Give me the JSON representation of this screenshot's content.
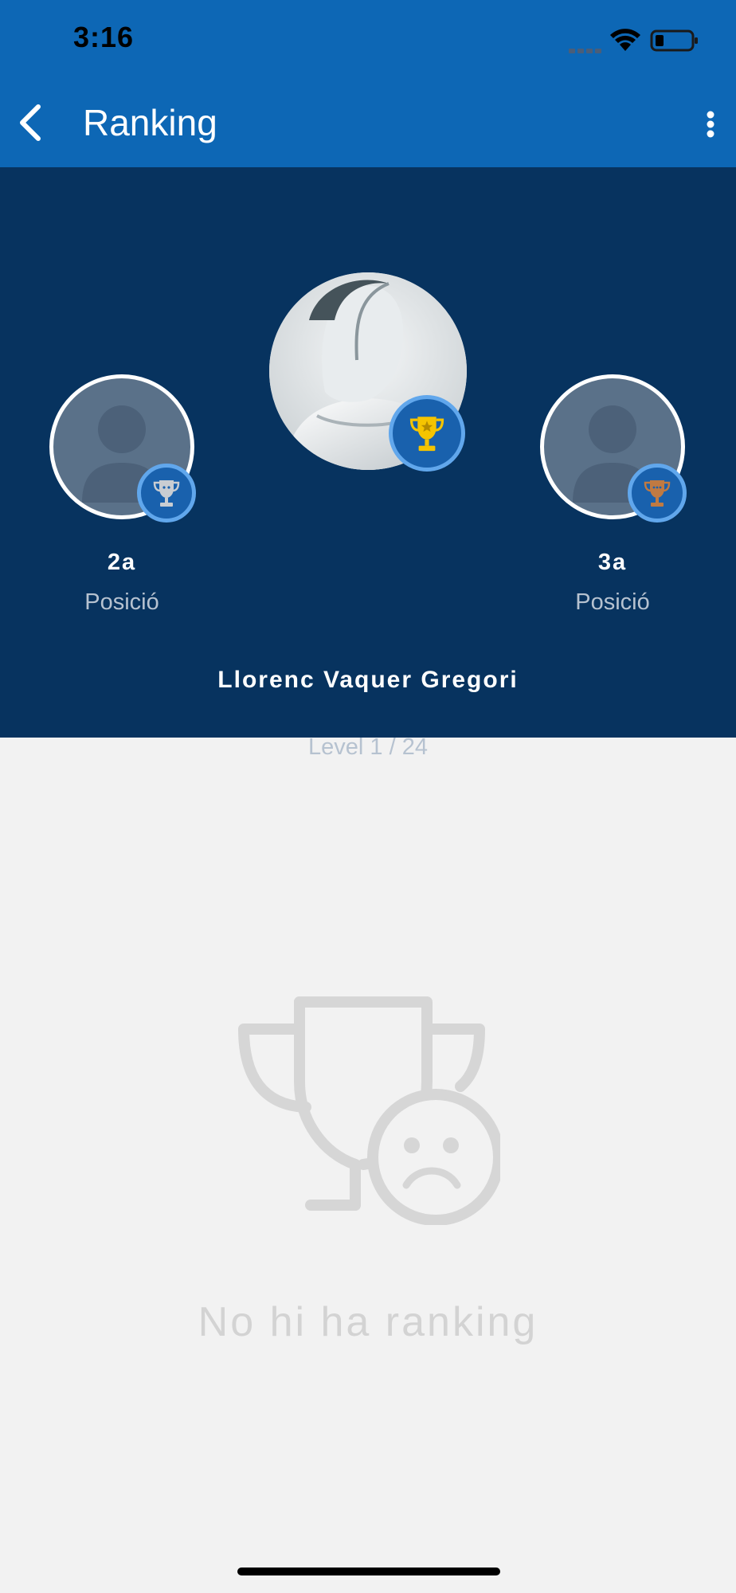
{
  "status_bar": {
    "time": "3:16",
    "icons": [
      "signal-icon",
      "wifi-icon",
      "battery-icon"
    ]
  },
  "app_bar": {
    "title": "Ranking",
    "back_icon": "chevron-left-icon",
    "menu_icon": "more-vertical-icon"
  },
  "podium": {
    "second": {
      "position": "2a",
      "label": "Posició",
      "badge": "silver-trophy-icon"
    },
    "first": {
      "name": "Llorenc Vaquer Gregori",
      "level": "Level 1 / 24",
      "badge": "gold-trophy-icon"
    },
    "third": {
      "position": "3a",
      "label": "Posició",
      "badge": "bronze-trophy-icon"
    }
  },
  "empty_state": {
    "icon": "sad-trophy-icon",
    "message": "No hi ha ranking"
  },
  "colors": {
    "app_bar": "#0d67b5",
    "podium_bg": "#07335f",
    "page_bg": "#f2f2f2",
    "gold": "#f5c400",
    "silver": "#c9cdd2",
    "bronze": "#c07a42",
    "empty_text": "#d3d3d3"
  }
}
